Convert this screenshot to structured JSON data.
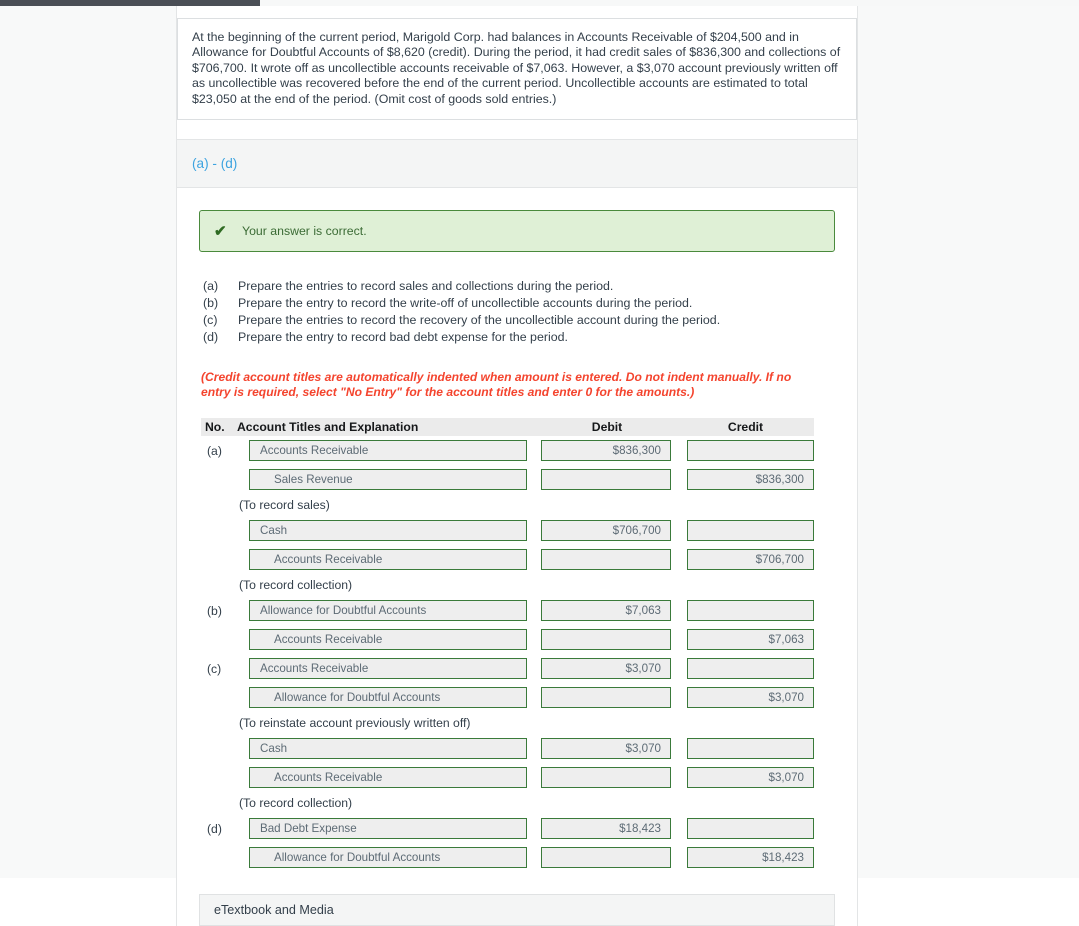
{
  "problem": {
    "text": "At the beginning of the current period, Marigold Corp. had balances in Accounts Receivable of $204,500 and in Allowance for Doubtful Accounts of $8,620 (credit). During the period, it had credit sales of $836,300 and collections of $706,700. It wrote off as uncollectible accounts receivable of $7,063. However, a $3,070 account previously written off as uncollectible was recovered before the end of the current period. Uncollectible accounts are estimated to total $23,050 at the end of the period. (Omit cost of goods sold entries.)"
  },
  "section": {
    "label": "(a) - (d)"
  },
  "banner": {
    "icon": "checkmark-icon",
    "glyph": "✔",
    "message": "Your answer is correct.",
    "bg_color": "#dff0d6",
    "border_color": "#4a8a3c",
    "text_color": "#3b6b35"
  },
  "requirements": [
    {
      "letter": "(a)",
      "text": "Prepare the entries to record sales and collections during the period."
    },
    {
      "letter": "(b)",
      "text": "Prepare the entry to record the write-off of uncollectible accounts during the period."
    },
    {
      "letter": "(c)",
      "text": "Prepare the entries to record the recovery of the uncollectible account during the period."
    },
    {
      "letter": "(d)",
      "text": "Prepare the entry to record bad debt expense for the period."
    }
  ],
  "instruction_note": {
    "text": "(Credit account titles are automatically indented when amount is entered. Do not indent manually. If no entry is required, select \"No Entry\" for the account titles and enter 0 for the amounts.)",
    "color": "#f4442e"
  },
  "journal": {
    "headers": {
      "no": "No.",
      "account": "Account Titles and Explanation",
      "debit": "Debit",
      "credit": "Credit"
    },
    "rows": [
      {
        "kind": "entry",
        "no": "(a)",
        "account": "Accounts Receivable",
        "indent": false,
        "debit": "$836,300",
        "credit": ""
      },
      {
        "kind": "entry",
        "no": "",
        "account": "Sales Revenue",
        "indent": true,
        "debit": "",
        "credit": "$836,300"
      },
      {
        "kind": "note",
        "text": "(To record sales)"
      },
      {
        "kind": "entry",
        "no": "",
        "account": "Cash",
        "indent": false,
        "debit": "$706,700",
        "credit": ""
      },
      {
        "kind": "entry",
        "no": "",
        "account": "Accounts Receivable",
        "indent": true,
        "debit": "",
        "credit": "$706,700"
      },
      {
        "kind": "note",
        "text": "(To record collection)"
      },
      {
        "kind": "entry",
        "no": "(b)",
        "account": "Allowance for Doubtful Accounts",
        "indent": false,
        "debit": "$7,063",
        "credit": ""
      },
      {
        "kind": "entry",
        "no": "",
        "account": "Accounts Receivable",
        "indent": true,
        "debit": "",
        "credit": "$7,063"
      },
      {
        "kind": "entry",
        "no": "(c)",
        "account": "Accounts Receivable",
        "indent": false,
        "debit": "$3,070",
        "credit": ""
      },
      {
        "kind": "entry",
        "no": "",
        "account": "Allowance for Doubtful Accounts",
        "indent": true,
        "debit": "",
        "credit": "$3,070"
      },
      {
        "kind": "note",
        "text": "(To reinstate account previously written off)"
      },
      {
        "kind": "entry",
        "no": "",
        "account": "Cash",
        "indent": false,
        "debit": "$3,070",
        "credit": ""
      },
      {
        "kind": "entry",
        "no": "",
        "account": "Accounts Receivable",
        "indent": true,
        "debit": "",
        "credit": "$3,070"
      },
      {
        "kind": "note",
        "text": "(To record collection)"
      },
      {
        "kind": "entry",
        "no": "(d)",
        "account": "Bad Debt Expense",
        "indent": false,
        "debit": "$18,423",
        "credit": ""
      },
      {
        "kind": "entry",
        "no": "",
        "account": "Allowance for Doubtful Accounts",
        "indent": true,
        "debit": "",
        "credit": "$18,423"
      }
    ]
  },
  "etextbook": {
    "label": "eTextbook and Media"
  }
}
